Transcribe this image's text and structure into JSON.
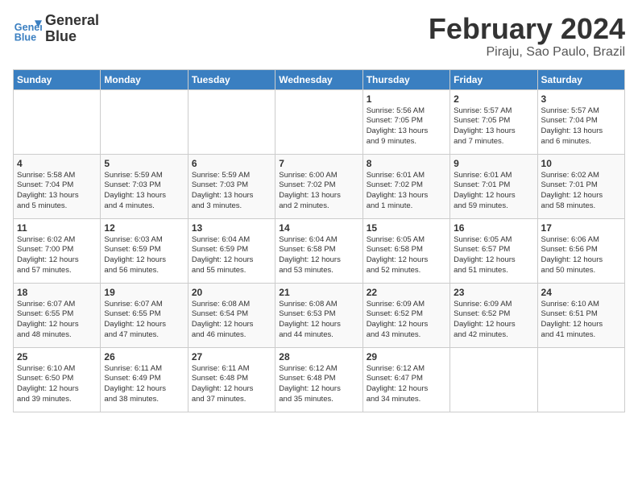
{
  "logo": {
    "line1": "General",
    "line2": "Blue"
  },
  "title": "February 2024",
  "location": "Piraju, Sao Paulo, Brazil",
  "weekdays": [
    "Sunday",
    "Monday",
    "Tuesday",
    "Wednesday",
    "Thursday",
    "Friday",
    "Saturday"
  ],
  "weeks": [
    [
      {
        "day": "",
        "info": ""
      },
      {
        "day": "",
        "info": ""
      },
      {
        "day": "",
        "info": ""
      },
      {
        "day": "",
        "info": ""
      },
      {
        "day": "1",
        "info": "Sunrise: 5:56 AM\nSunset: 7:05 PM\nDaylight: 13 hours\nand 9 minutes."
      },
      {
        "day": "2",
        "info": "Sunrise: 5:57 AM\nSunset: 7:05 PM\nDaylight: 13 hours\nand 7 minutes."
      },
      {
        "day": "3",
        "info": "Sunrise: 5:57 AM\nSunset: 7:04 PM\nDaylight: 13 hours\nand 6 minutes."
      }
    ],
    [
      {
        "day": "4",
        "info": "Sunrise: 5:58 AM\nSunset: 7:04 PM\nDaylight: 13 hours\nand 5 minutes."
      },
      {
        "day": "5",
        "info": "Sunrise: 5:59 AM\nSunset: 7:03 PM\nDaylight: 13 hours\nand 4 minutes."
      },
      {
        "day": "6",
        "info": "Sunrise: 5:59 AM\nSunset: 7:03 PM\nDaylight: 13 hours\nand 3 minutes."
      },
      {
        "day": "7",
        "info": "Sunrise: 6:00 AM\nSunset: 7:02 PM\nDaylight: 13 hours\nand 2 minutes."
      },
      {
        "day": "8",
        "info": "Sunrise: 6:01 AM\nSunset: 7:02 PM\nDaylight: 13 hours\nand 1 minute."
      },
      {
        "day": "9",
        "info": "Sunrise: 6:01 AM\nSunset: 7:01 PM\nDaylight: 12 hours\nand 59 minutes."
      },
      {
        "day": "10",
        "info": "Sunrise: 6:02 AM\nSunset: 7:01 PM\nDaylight: 12 hours\nand 58 minutes."
      }
    ],
    [
      {
        "day": "11",
        "info": "Sunrise: 6:02 AM\nSunset: 7:00 PM\nDaylight: 12 hours\nand 57 minutes."
      },
      {
        "day": "12",
        "info": "Sunrise: 6:03 AM\nSunset: 6:59 PM\nDaylight: 12 hours\nand 56 minutes."
      },
      {
        "day": "13",
        "info": "Sunrise: 6:04 AM\nSunset: 6:59 PM\nDaylight: 12 hours\nand 55 minutes."
      },
      {
        "day": "14",
        "info": "Sunrise: 6:04 AM\nSunset: 6:58 PM\nDaylight: 12 hours\nand 53 minutes."
      },
      {
        "day": "15",
        "info": "Sunrise: 6:05 AM\nSunset: 6:58 PM\nDaylight: 12 hours\nand 52 minutes."
      },
      {
        "day": "16",
        "info": "Sunrise: 6:05 AM\nSunset: 6:57 PM\nDaylight: 12 hours\nand 51 minutes."
      },
      {
        "day": "17",
        "info": "Sunrise: 6:06 AM\nSunset: 6:56 PM\nDaylight: 12 hours\nand 50 minutes."
      }
    ],
    [
      {
        "day": "18",
        "info": "Sunrise: 6:07 AM\nSunset: 6:55 PM\nDaylight: 12 hours\nand 48 minutes."
      },
      {
        "day": "19",
        "info": "Sunrise: 6:07 AM\nSunset: 6:55 PM\nDaylight: 12 hours\nand 47 minutes."
      },
      {
        "day": "20",
        "info": "Sunrise: 6:08 AM\nSunset: 6:54 PM\nDaylight: 12 hours\nand 46 minutes."
      },
      {
        "day": "21",
        "info": "Sunrise: 6:08 AM\nSunset: 6:53 PM\nDaylight: 12 hours\nand 44 minutes."
      },
      {
        "day": "22",
        "info": "Sunrise: 6:09 AM\nSunset: 6:52 PM\nDaylight: 12 hours\nand 43 minutes."
      },
      {
        "day": "23",
        "info": "Sunrise: 6:09 AM\nSunset: 6:52 PM\nDaylight: 12 hours\nand 42 minutes."
      },
      {
        "day": "24",
        "info": "Sunrise: 6:10 AM\nSunset: 6:51 PM\nDaylight: 12 hours\nand 41 minutes."
      }
    ],
    [
      {
        "day": "25",
        "info": "Sunrise: 6:10 AM\nSunset: 6:50 PM\nDaylight: 12 hours\nand 39 minutes."
      },
      {
        "day": "26",
        "info": "Sunrise: 6:11 AM\nSunset: 6:49 PM\nDaylight: 12 hours\nand 38 minutes."
      },
      {
        "day": "27",
        "info": "Sunrise: 6:11 AM\nSunset: 6:48 PM\nDaylight: 12 hours\nand 37 minutes."
      },
      {
        "day": "28",
        "info": "Sunrise: 6:12 AM\nSunset: 6:48 PM\nDaylight: 12 hours\nand 35 minutes."
      },
      {
        "day": "29",
        "info": "Sunrise: 6:12 AM\nSunset: 6:47 PM\nDaylight: 12 hours\nand 34 minutes."
      },
      {
        "day": "",
        "info": ""
      },
      {
        "day": "",
        "info": ""
      }
    ]
  ]
}
